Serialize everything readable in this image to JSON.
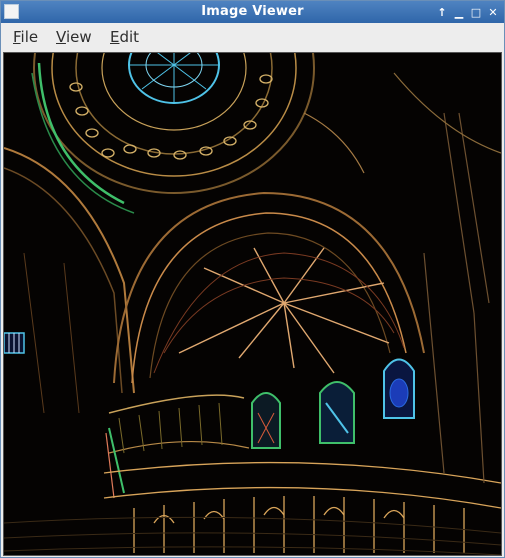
{
  "window": {
    "title": "Image Viewer"
  },
  "controls": {
    "keep_above": "↑",
    "minimize": "▁",
    "maximize": "□",
    "close": "✕"
  },
  "menu": [
    {
      "mnemonic": "F",
      "rest": "ile"
    },
    {
      "mnemonic": "V",
      "rest": "iew"
    },
    {
      "mnemonic": "E",
      "rest": "dit"
    }
  ],
  "colors": {
    "titlebar": "#3a72b6",
    "edge_warm": "#c98a4a",
    "edge_cool": "#4fc3e8",
    "edge_green": "#3fbf6a"
  }
}
